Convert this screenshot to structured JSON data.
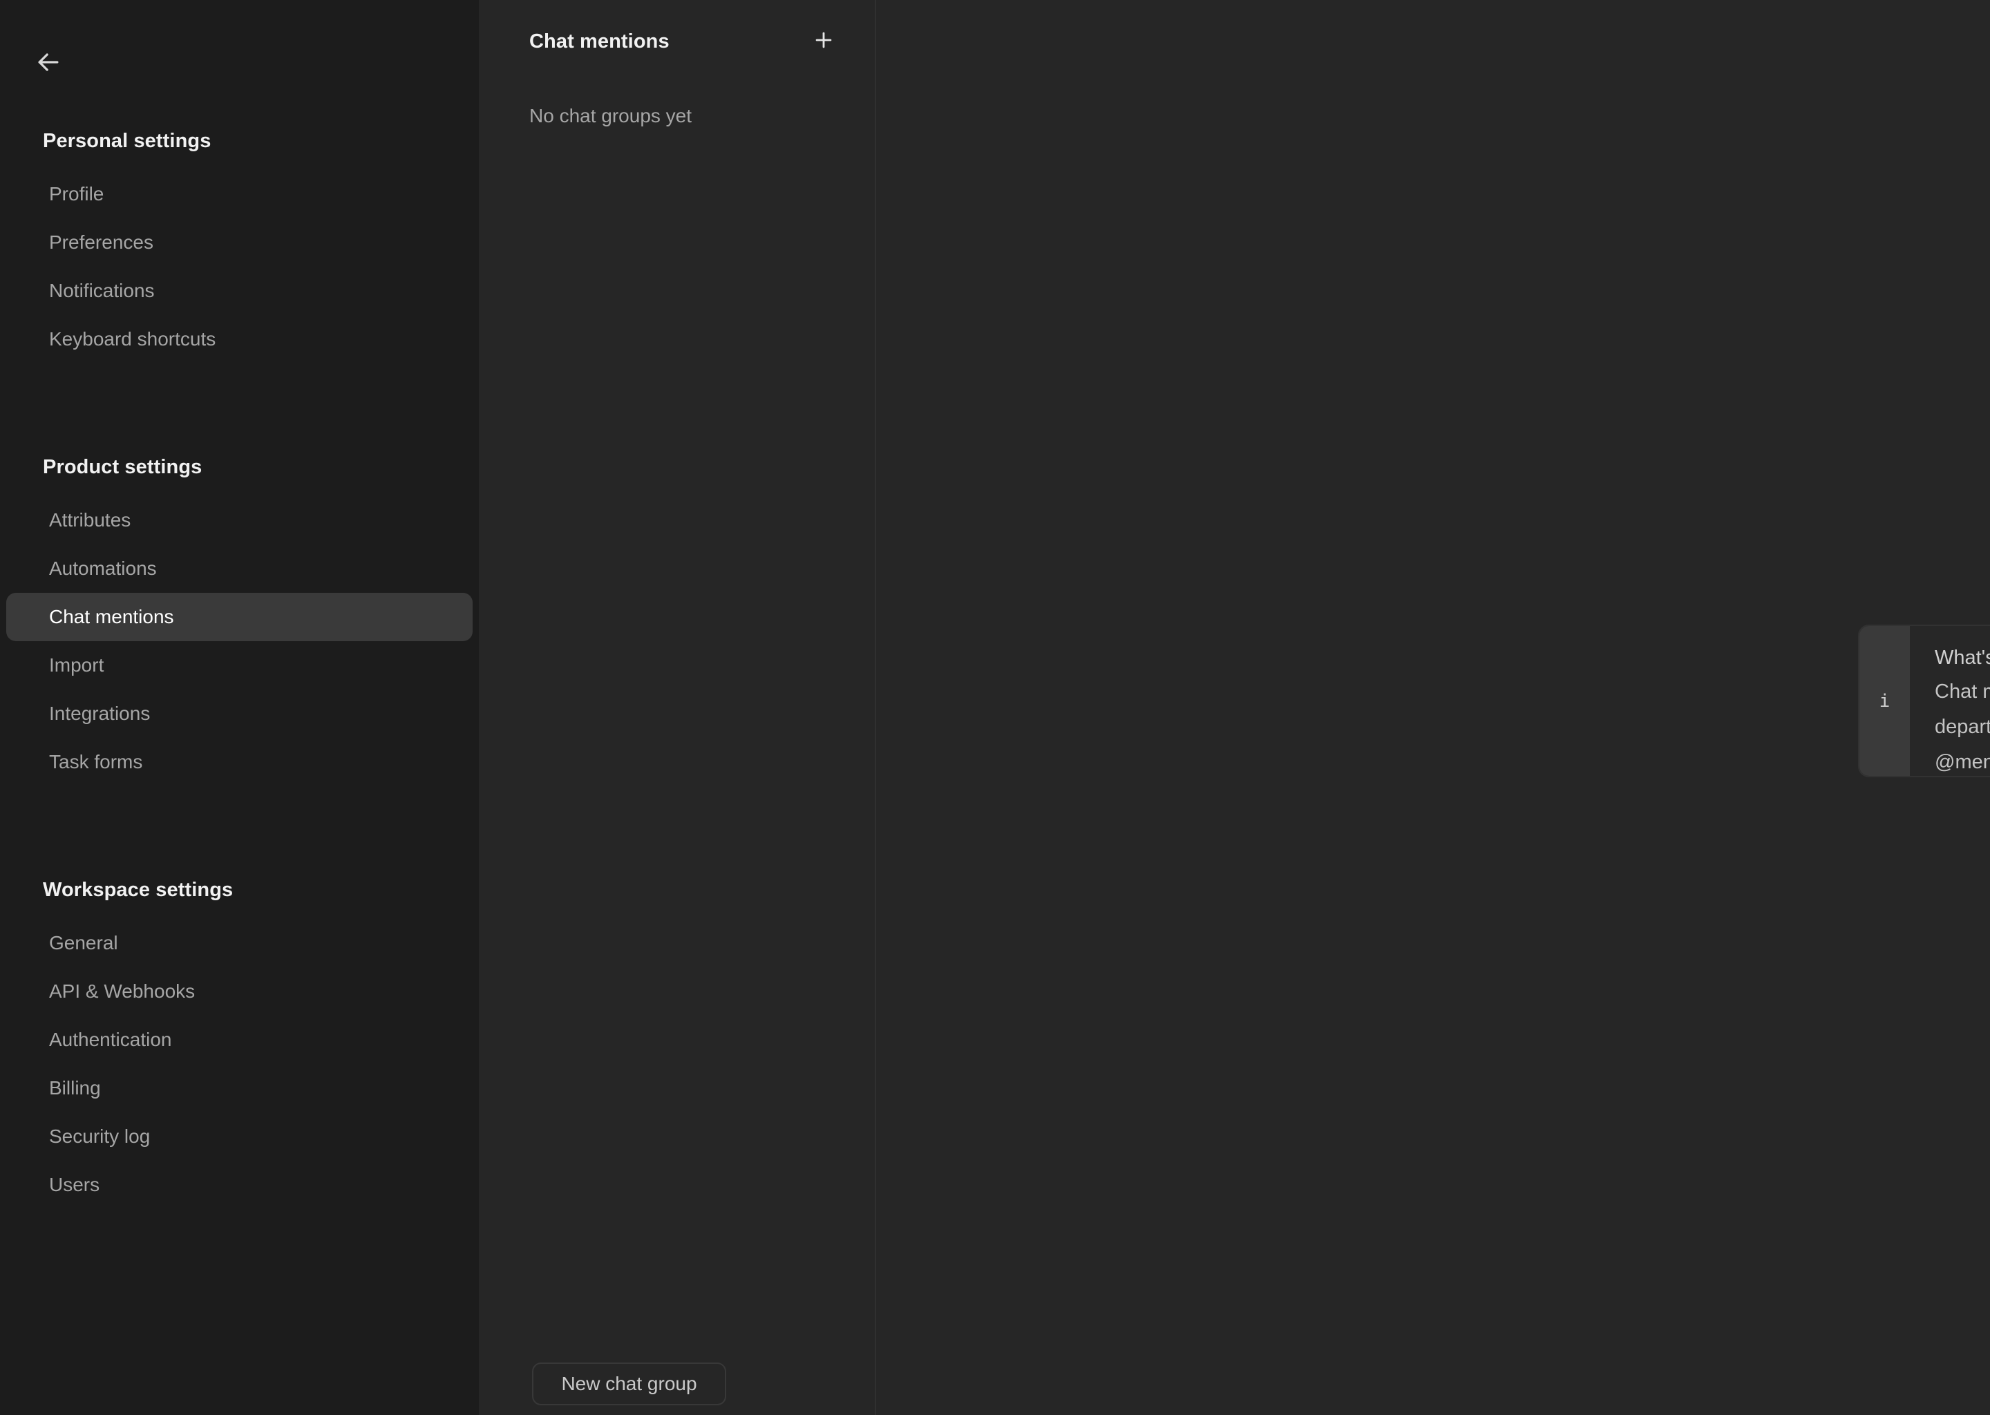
{
  "sidebar": {
    "back_icon": "arrow-left-icon",
    "sections": [
      {
        "title": "Personal settings",
        "items": [
          {
            "label": "Profile",
            "active": false
          },
          {
            "label": "Preferences",
            "active": false
          },
          {
            "label": "Notifications",
            "active": false
          },
          {
            "label": "Keyboard shortcuts",
            "active": false
          }
        ]
      },
      {
        "title": "Product settings",
        "items": [
          {
            "label": "Attributes",
            "active": false
          },
          {
            "label": "Automations",
            "active": false
          },
          {
            "label": "Chat mentions",
            "active": true
          },
          {
            "label": "Import",
            "active": false
          },
          {
            "label": "Integrations",
            "active": false
          },
          {
            "label": "Task forms",
            "active": false
          }
        ]
      },
      {
        "title": "Workspace settings",
        "items": [
          {
            "label": "General",
            "active": false
          },
          {
            "label": "API & Webhooks",
            "active": false
          },
          {
            "label": "Authentication",
            "active": false
          },
          {
            "label": "Billing",
            "active": false
          },
          {
            "label": "Security log",
            "active": false
          },
          {
            "label": "Users",
            "active": false
          }
        ]
      }
    ]
  },
  "middle_panel": {
    "title": "Chat mentions",
    "add_icon": "plus-icon",
    "empty_state": "No chat groups yet",
    "new_group_label": "New chat group"
  },
  "main": {
    "callout": {
      "icon": "info-icon",
      "icon_glyph": "i",
      "heading": "What's a chat mention?",
      "text": "Chat mentions let you notify several people in your workspace, like a team or department, at the same time. You can mention the group the same way you @mention individuals, like @support."
    }
  },
  "colors": {
    "sidebar_bg": "#1c1c1c",
    "panel_bg": "#262626",
    "active_item_bg": "#3a3a3a",
    "divider": "#303030",
    "heading_text": "#f2f2f2",
    "muted_text": "#a6a6a6",
    "callout_border": "#323232",
    "callout_gutter": "#3a3a3a"
  }
}
